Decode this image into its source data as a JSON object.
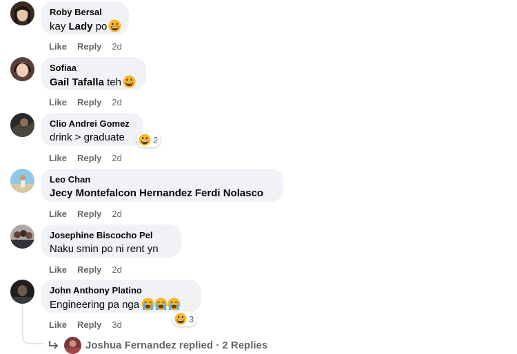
{
  "comments": [
    {
      "author": "Roby Bersal",
      "pre": "kay ",
      "bold": "Lady",
      "post": " po",
      "emojis": 1,
      "time": "2d",
      "bubble_w": 128
    },
    {
      "author": "Sofiaa",
      "pre": "",
      "bold": "Gail Tafalla",
      "post": " teh",
      "emojis": 1,
      "time": "2d",
      "bubble_w": 153
    },
    {
      "author": "Clio Andrei Gomez",
      "pre": "drink > graduate",
      "bold": "",
      "post": "",
      "emojis": 0,
      "time": "2d",
      "bubble_w": 149,
      "reaction_count": "2"
    },
    {
      "author": "Leo Chan",
      "pre": "",
      "bold": "Jecy Montefalcon Hernandez Ferdi Nolasco",
      "post": "",
      "emojis": 0,
      "time": "2d",
      "bubble_w": 352
    },
    {
      "author": "Josephine Biscocho Pel",
      "pre": "Naku smin po ni rent yn",
      "bold": "",
      "post": "",
      "emojis": 0,
      "time": "2d",
      "bubble_w": 204
    },
    {
      "author": "John Anthony Platino",
      "pre": "Engineering pa nga",
      "bold": "",
      "post": "",
      "emojis": 3,
      "time": "3d",
      "bubble_w": 233,
      "reaction_count": "3"
    }
  ],
  "actions": {
    "like": "Like",
    "reply": "Reply"
  },
  "replies": {
    "text": "Joshua Fernandez replied · 2 Replies"
  },
  "icons": {
    "reply_arrow": "reply-arrow-icon",
    "grin": "grinning-emoji-icon",
    "cry": "loudly-crying-emoji-icon"
  },
  "colors": {
    "bubble": "#f0f2f5",
    "meta": "#65676b",
    "text": "#050505"
  }
}
